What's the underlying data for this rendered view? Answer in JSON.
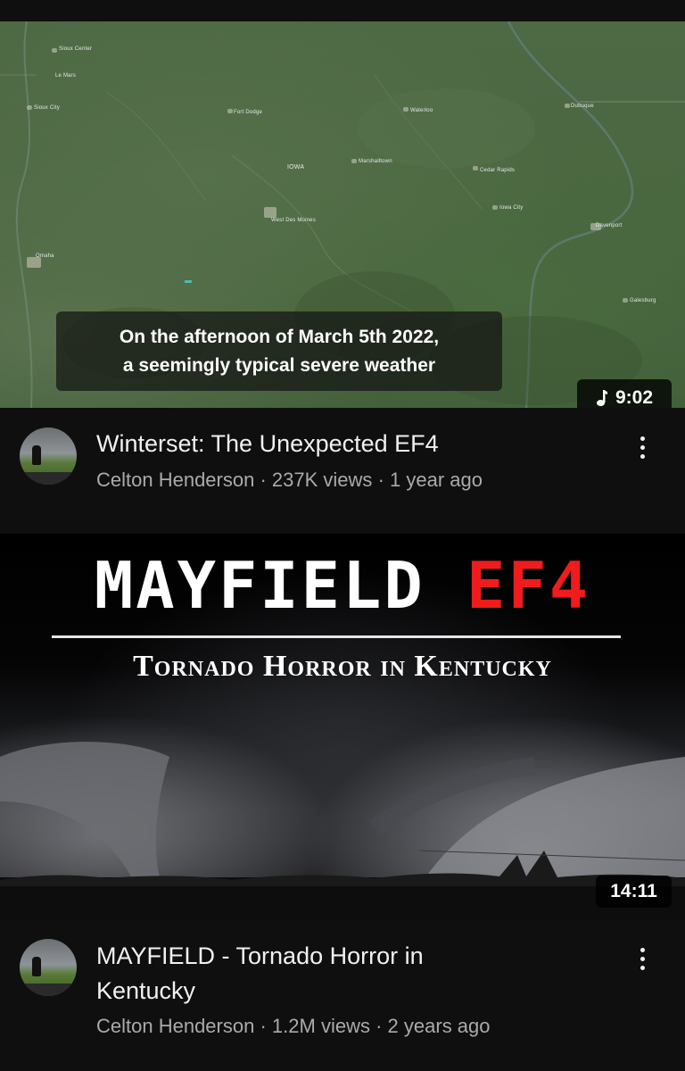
{
  "videos": [
    {
      "thumbnail": {
        "caption_line1": "On the afternoon of March 5th 2022,",
        "caption_line2": "a seemingly typical severe weather",
        "duration": "9:02",
        "duration_icon": "music-note-icon",
        "map_labels": [
          "Sioux Center",
          "Le Mars",
          "Sioux City",
          "Fort Dodge",
          "IOWA",
          "Marshalltown",
          "Waterloo",
          "Dubuque",
          "Cedar Rapids",
          "Iowa City",
          "West Des Moines",
          "Davenport",
          "Omaha",
          "Galesburg"
        ]
      },
      "title": "Winterset: The Unexpected EF4",
      "channel": "Celton Henderson",
      "views": "237K views",
      "age": "1 year ago",
      "separator": "·"
    },
    {
      "thumbnail": {
        "headline_white": "MAYFIELD",
        "headline_red": "EF4",
        "subtitle": "Tornado Horror in Kentucky",
        "duration": "14:11"
      },
      "title_line1": "MAYFIELD - Tornado Horror in",
      "title_line2": "Kentucky",
      "channel": "Celton Henderson",
      "views": "1.2M views",
      "age": "2 years ago",
      "separator": "·"
    }
  ],
  "colors": {
    "background": "#0f0f0f",
    "primary_text": "#f1f1f1",
    "secondary_text": "#aaaaaa",
    "accent_red": "#ee1c1c"
  }
}
